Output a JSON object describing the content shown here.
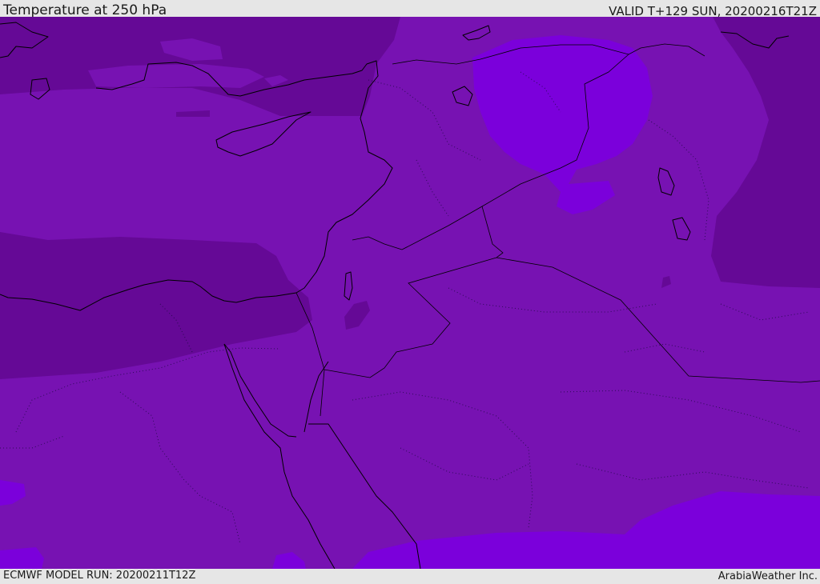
{
  "header": {
    "title": "Temperature at 250 hPa",
    "valid": "VALID T+129 SUN, 20200216T21Z"
  },
  "footer": {
    "model_run": "ECMWF MODEL RUN: 20200211T12Z",
    "credit": "ArabiaWeather Inc."
  },
  "colors": {
    "band_mid": "#7712b2",
    "band_cold": "#650996",
    "band_warm": "#7b00db",
    "band_warmest": "#8000e8"
  }
}
